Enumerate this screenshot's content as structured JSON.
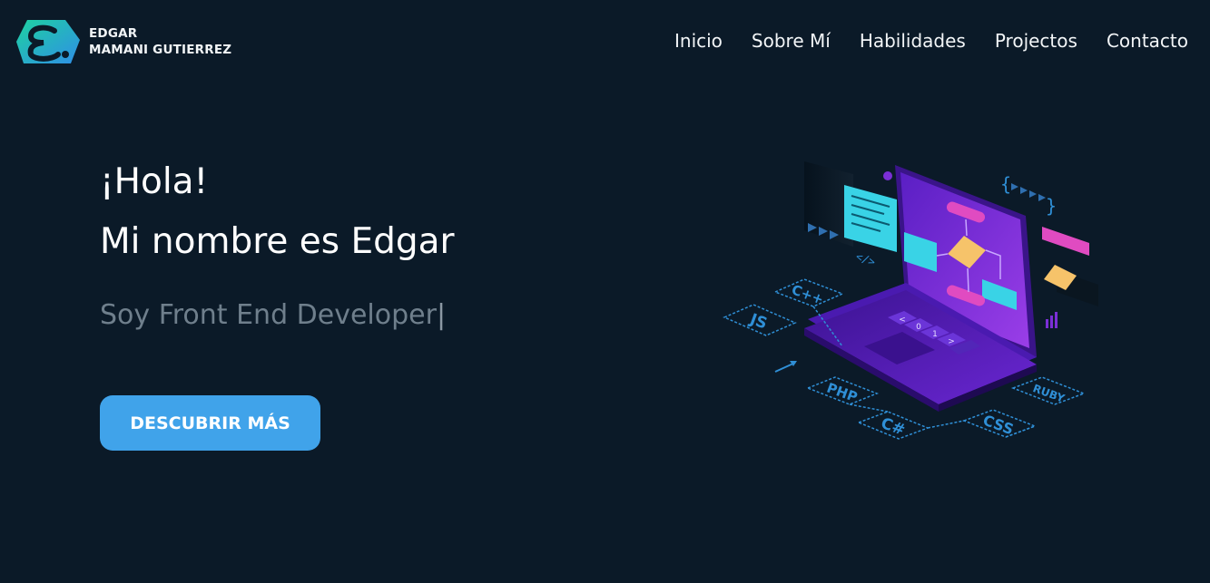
{
  "brand": {
    "first_name": "EDGAR",
    "last_name": "MAMANI GUTIERREZ",
    "logo_icon": "e-letter-logo-icon",
    "logo_color_start": "#1ed1a1",
    "logo_color_end": "#2f8fe6"
  },
  "nav": {
    "items": [
      {
        "label": "Inicio"
      },
      {
        "label": "Sobre Mí"
      },
      {
        "label": "Habilidades"
      },
      {
        "label": "Projectos"
      },
      {
        "label": "Contacto"
      }
    ]
  },
  "hero": {
    "greeting": "¡Hola!",
    "name_line": "Mi nombre es Edgar",
    "role": "Soy Front End Developer",
    "cursor": "|",
    "cta_label": "DESCUBRIR MÁS"
  },
  "illustration": {
    "tags": [
      "C++",
      "JS",
      "PHP",
      "C#",
      "CSS",
      "RUBY"
    ],
    "keys": [
      "<",
      "0",
      "1",
      ">"
    ],
    "code_tag": "</>",
    "accent_purple": "#7b2fd6",
    "accent_cyan": "#39d3e6",
    "tag_color": "#2f8fd6"
  },
  "theme": {
    "background": "#0b1a28",
    "button_color": "#40a3ea",
    "muted_text": "#6f7f8c"
  }
}
